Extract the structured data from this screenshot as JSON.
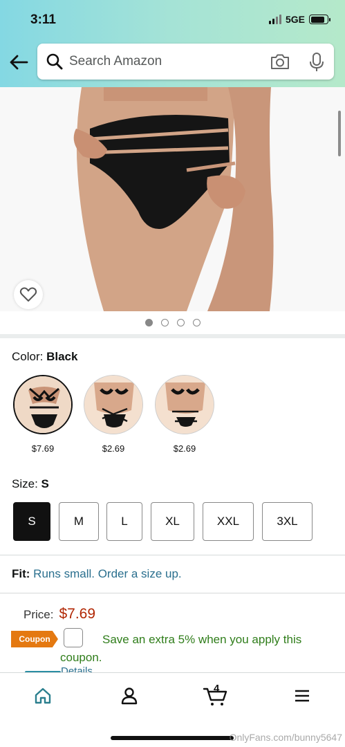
{
  "status_bar": {
    "time": "3:11",
    "network": "5GE"
  },
  "search": {
    "placeholder": "Search Amazon"
  },
  "product": {
    "image_count": 4,
    "active_image": 1,
    "color": {
      "label": "Color:",
      "value": "Black"
    },
    "swatches": [
      {
        "price": "$7.69",
        "selected": true
      },
      {
        "price": "$2.69",
        "selected": false
      },
      {
        "price": "$2.69",
        "selected": false
      }
    ],
    "size": {
      "label": "Size:",
      "value": "S",
      "options": [
        "S",
        "M",
        "L",
        "XL",
        "XXL",
        "3XL"
      ]
    },
    "fit": {
      "label": "Fit:",
      "text": "Runs small. Order a size up."
    },
    "price": {
      "label": "Price:",
      "value": "$7.69"
    },
    "coupon": {
      "tag": "Coupon",
      "text": "Save an extra 5% when you apply this coupon.",
      "details": "Details"
    }
  },
  "nav": {
    "cart_count": "4"
  },
  "watermark": "OnlyFans.com/bunny5647",
  "colors": {
    "accent": "#e47911",
    "price": "#b12704",
    "link": "#2a6f8e",
    "coupon_text": "#2f7d1a"
  }
}
